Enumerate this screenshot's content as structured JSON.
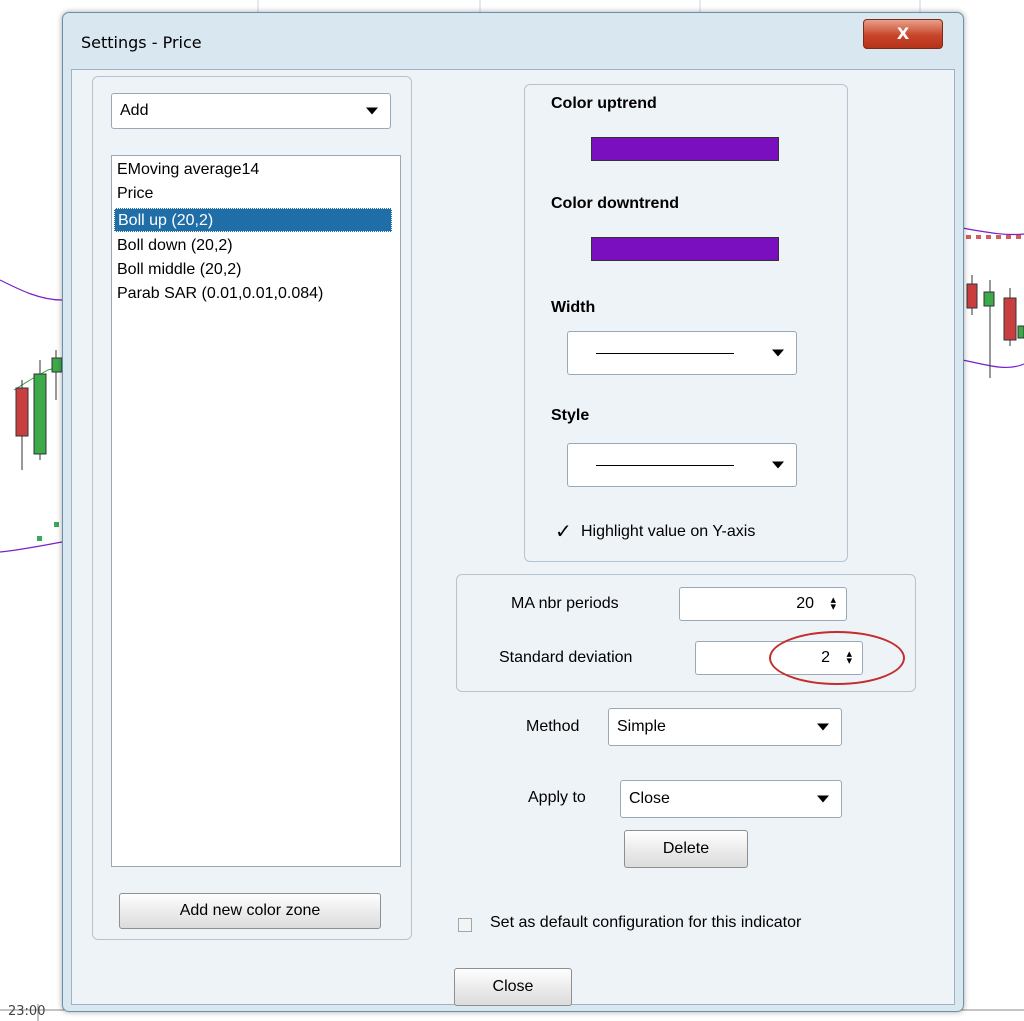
{
  "window": {
    "title": "Settings - Price",
    "close_glyph": "X"
  },
  "background": {
    "time_label": "23:00"
  },
  "left_panel": {
    "add_select": {
      "value": "Add"
    },
    "indicators": [
      "EMoving average14",
      "Price",
      "Boll up (20,2)",
      "Boll down (20,2)",
      "Boll middle (20,2)",
      "Parab SAR (0.01,0.01,0.084)"
    ],
    "selected_index": 2,
    "add_zone_button": "Add new color zone"
  },
  "style_group": {
    "color_uptrend_label": "Color uptrend",
    "color_uptrend": "#7a0fbf",
    "color_downtrend_label": "Color downtrend",
    "color_downtrend": "#7a0fbf",
    "width_label": "Width",
    "style_label": "Style",
    "highlight_label": "Highlight value on Y-axis",
    "highlight_checked": true
  },
  "params_group": {
    "ma_periods_label": "MA nbr periods",
    "ma_periods_value": "20",
    "std_dev_label": "Standard deviation",
    "std_dev_value": "2"
  },
  "method": {
    "label": "Method",
    "value": "Simple"
  },
  "apply_to": {
    "label": "Apply to",
    "value": "Close"
  },
  "delete_button": "Delete",
  "default_config_label": "Set as default configuration for this indicator",
  "close_button": "Close",
  "icons": {
    "dropdown": "chevron-down-icon",
    "spinner": "spinner-arrows-icon",
    "check": "checkmark-icon"
  }
}
